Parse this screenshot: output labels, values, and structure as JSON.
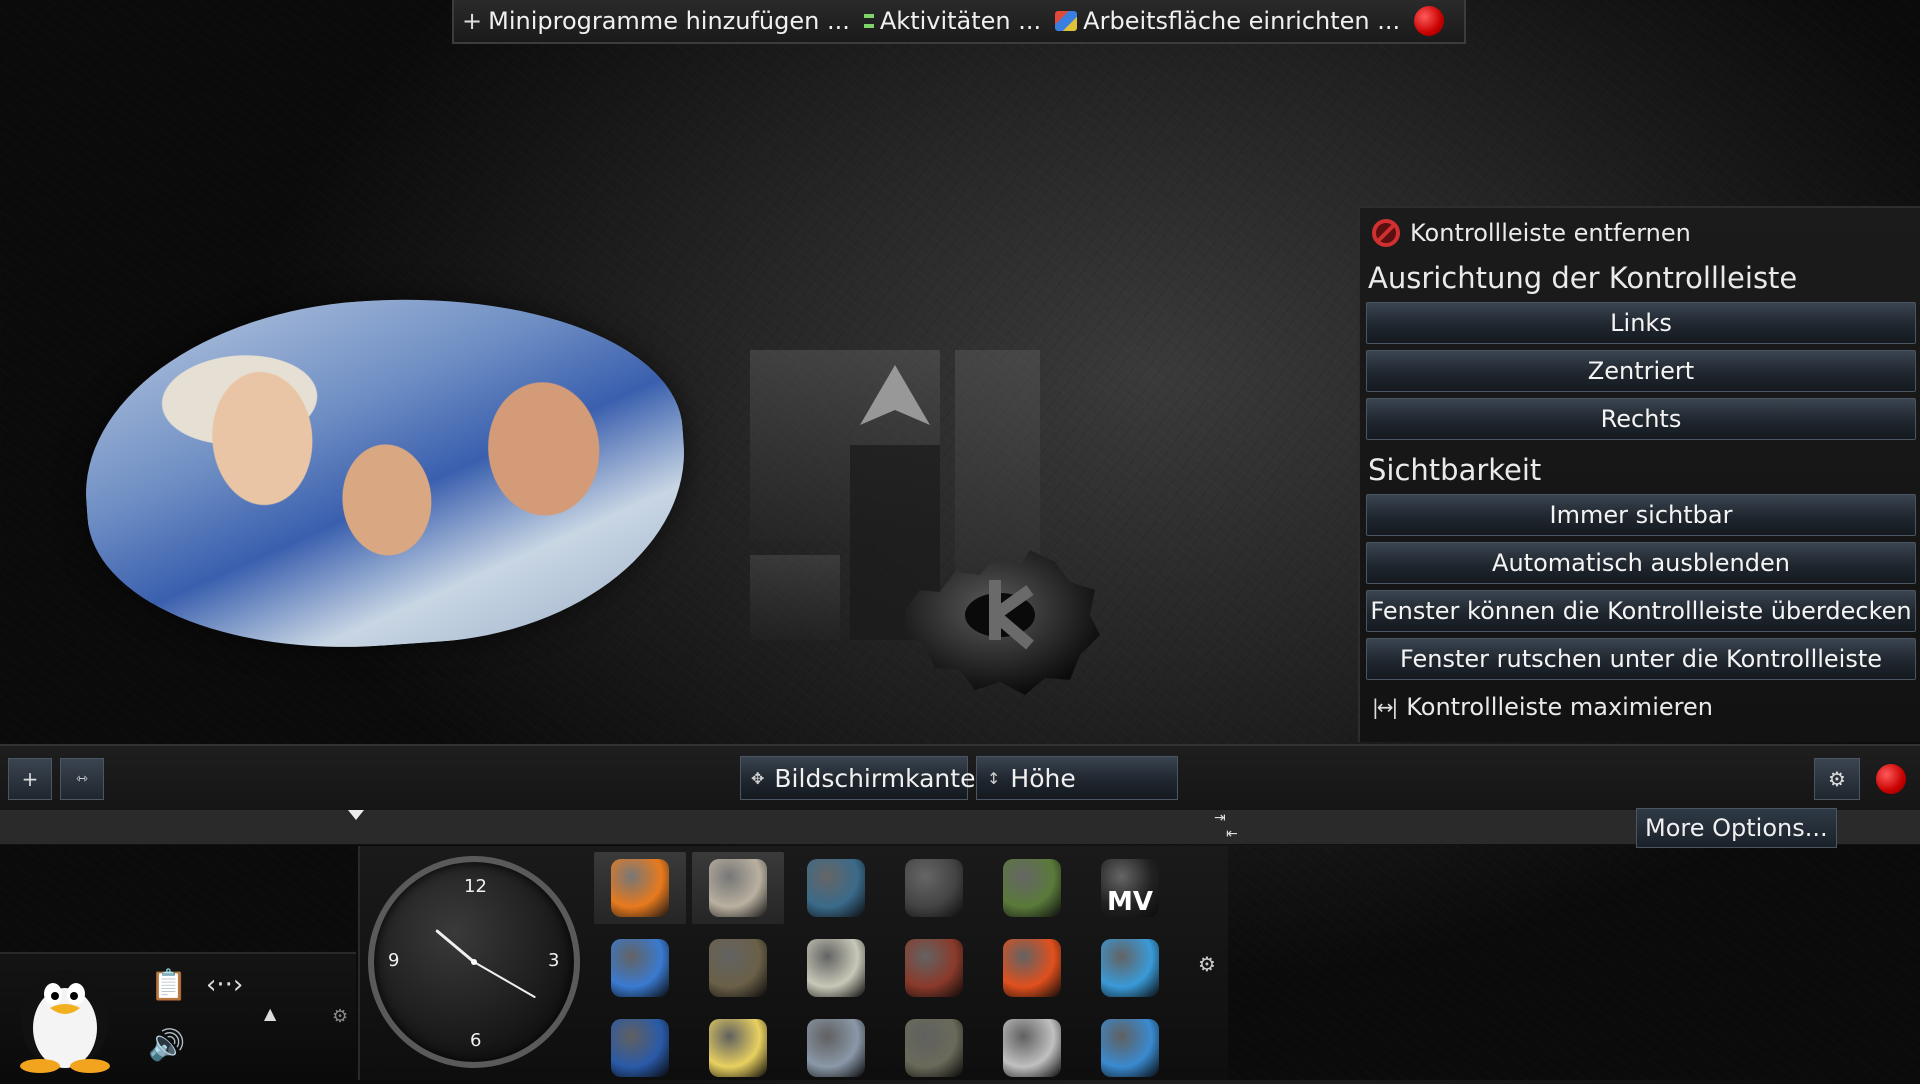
{
  "toolbox": {
    "add_widgets": "Miniprogramme hinzufügen ...",
    "activities": "Aktivitäten ...",
    "configure_desktop": "Arbeitsfläche einrichten ..."
  },
  "panel_menu": {
    "remove_panel": "Kontrollleiste entfernen",
    "alignment_title": "Ausrichtung der Kontrollleiste",
    "alignment_options": [
      "Links",
      "Zentriert",
      "Rechts"
    ],
    "visibility_title": "Sichtbarkeit",
    "visibility_options": [
      "Immer sichtbar",
      "Automatisch ausblenden",
      "Fenster können die Kontrollleiste überdecken",
      "Fenster rutschen unter die Kontrollleiste"
    ],
    "maximize_panel": "Kontrollleiste maximieren"
  },
  "controller": {
    "add_symbol": "+",
    "screen_edge_label": "Bildschirmkante",
    "height_label": "Höhe",
    "more_options": "More Options..."
  },
  "clock": {
    "numbers": [
      "12",
      "3",
      "6",
      "9"
    ],
    "time_display": "10:20"
  },
  "launchers": [
    {
      "name": "firefox-icon"
    },
    {
      "name": "file-cabinet-icon"
    },
    {
      "name": "typewriter-icon"
    },
    {
      "name": "camera-icon"
    },
    {
      "name": "network-monitor-icon"
    },
    {
      "name": "movie-editor-icon"
    },
    {
      "name": "globe-icon"
    },
    {
      "name": "terminal-icon"
    },
    {
      "name": "calculator-icon"
    },
    {
      "name": "photo-viewer-icon"
    },
    {
      "name": "burner-icon"
    },
    {
      "name": "wireless-icon"
    },
    {
      "name": "thunderbird-icon"
    },
    {
      "name": "notes-icon"
    },
    {
      "name": "scanner-icon"
    },
    {
      "name": "gimp-icon"
    },
    {
      "name": "tape-recorder-icon"
    },
    {
      "name": "paint-icon"
    }
  ],
  "launcher_label_mv": "MV",
  "colors": {
    "close_red": "#c80000",
    "button_blue": "#2a333d",
    "background": "#1a1a1a"
  }
}
